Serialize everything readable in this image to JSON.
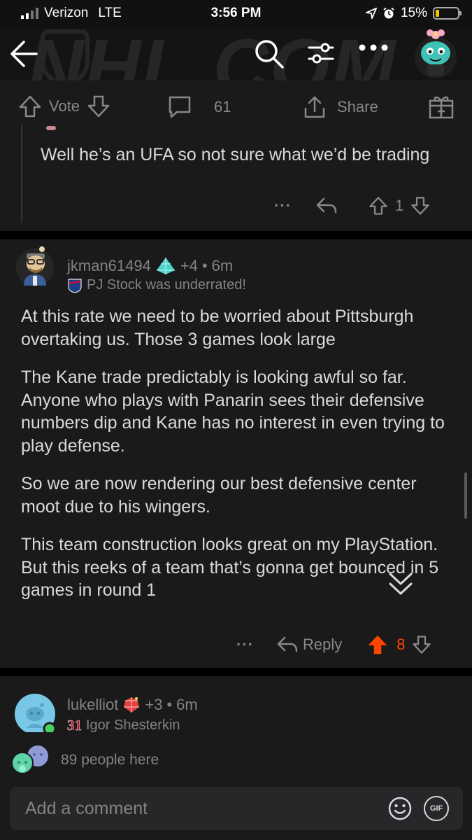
{
  "status_bar": {
    "carrier": "Verizon",
    "network": "LTE",
    "time": "3:56 PM",
    "battery": "15%",
    "battery_color": "#f5c400"
  },
  "header": {
    "background_logo": "NHL.COM",
    "back_icon": "back-arrow-icon",
    "search_icon": "search-icon",
    "sort_icon": "sort-icon",
    "more_icon": "more-icon"
  },
  "post_actions": {
    "vote_label": "Vote",
    "comment_count": "61",
    "share_label": "Share"
  },
  "reply_comment": {
    "text": "Well he’s an UFA so not sure what we’d be trading",
    "more": "···",
    "score": "1"
  },
  "main_comment": {
    "username": "jkman61494",
    "karma": "+4",
    "separator": "•",
    "time": "6m",
    "flair": "PJ Stock was underrated!",
    "paragraphs": [
      "At this rate we need to be worried about Pittsburgh overtaking us. Those 3 games look large",
      "The Kane trade predictably is looking awful so far. Anyone who plays with Panarin sees their defensive numbers dip and Kane has no interest in even trying to play defense.",
      "So we are now rendering our best defensive center moot due to his wingers.",
      "This team construction looks great on my PlayStation. But this reeks of a team that’s gonna get bounced in 5 games in round 1"
    ],
    "more": "···",
    "reply_label": "Reply",
    "score": "8",
    "upvote_color": "#ff4500"
  },
  "next_comment": {
    "username": "lukelliot",
    "karma": "+3",
    "separator": "•",
    "time": "6m",
    "flair_number": "31",
    "flair": "Igor Shesterkin"
  },
  "presence": {
    "text": "89 people here"
  },
  "comment_input": {
    "placeholder": "Add a comment",
    "gif_label": "GIF"
  }
}
